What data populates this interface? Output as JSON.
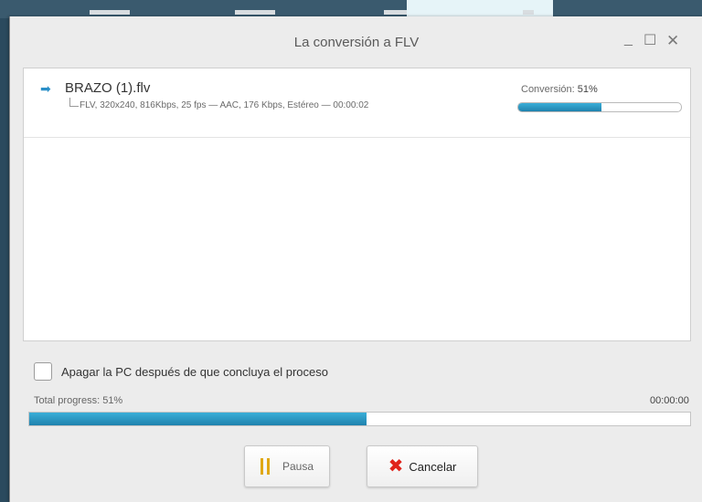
{
  "window": {
    "title": "La conversión a FLV",
    "controls": {
      "minimize": "_",
      "maximize": "☐",
      "close": "✕"
    }
  },
  "items": [
    {
      "icon": "right-arrow-icon",
      "filename": "BRAZO (1).flv",
      "details": "FLV, 320x240, 816Kbps, 25 fps — AAC, 176 Kbps, Estéreo — 00:00:02",
      "status_label": "Conversión:",
      "progress_text": "51%",
      "progress": 0.51
    }
  ],
  "shutdown_option": {
    "label": "Apagar la PC después de que concluya el proceso",
    "checked": false
  },
  "total": {
    "label": "Total progress: 51%",
    "time": "00:00:00",
    "progress": 0.51
  },
  "buttons": {
    "pause": "Pausa",
    "cancel": "Cancelar"
  },
  "colors": {
    "accent": "#2a8fc8",
    "pause_icon": "#e0a814",
    "cancel_icon": "#e0231b"
  }
}
